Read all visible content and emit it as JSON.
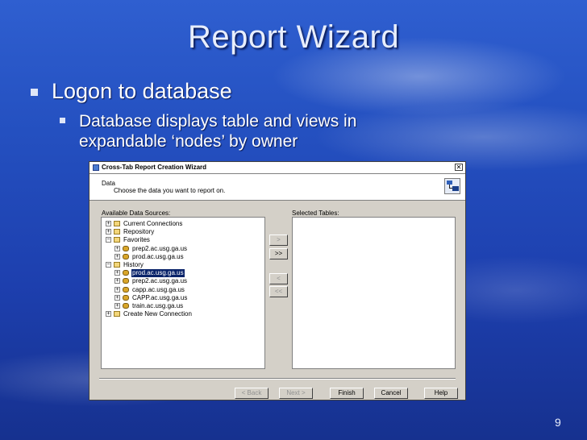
{
  "slide": {
    "title": "Report Wizard",
    "bullets": [
      {
        "text": "Logon to database",
        "level": 1
      },
      {
        "text": "Database displays table and views in expandable ‘nodes’ by owner",
        "level": 2
      }
    ],
    "page_number": "9"
  },
  "dialog": {
    "title": "Cross-Tab Report Creation Wizard",
    "close_glyph": "✕",
    "header_title": "Data",
    "header_subtitle": "Choose the data you want to report on.",
    "available_label": "Available Data Sources:",
    "selected_label": "Selected Tables:",
    "tree": [
      {
        "label": "Current Connections",
        "icon": "folder-icon",
        "expander": "+",
        "depth": 0
      },
      {
        "label": "Repository",
        "icon": "folder-icon",
        "expander": "+",
        "depth": 0
      },
      {
        "label": "Favorites",
        "icon": "folder-icon",
        "expander": "−",
        "depth": 0
      },
      {
        "label": "prep2.ac.usg.ga.us",
        "icon": "database-icon",
        "expander": "+",
        "depth": 1
      },
      {
        "label": "prod.ac.usg.ga.us",
        "icon": "database-icon",
        "expander": "+",
        "depth": 1
      },
      {
        "label": "History",
        "icon": "folder-icon",
        "expander": "−",
        "depth": 0
      },
      {
        "label": "prod.ac.usg.ga.us",
        "icon": "database-icon",
        "expander": "+",
        "depth": 1,
        "selected": true
      },
      {
        "label": "prep2.ac.usg.ga.us",
        "icon": "database-icon",
        "expander": "+",
        "depth": 1
      },
      {
        "label": "capp.ac.usg.ga.us",
        "icon": "database-icon",
        "expander": "+",
        "depth": 1
      },
      {
        "label": "CAPP.ac.usg.ga.us",
        "icon": "database-icon",
        "expander": "+",
        "depth": 1
      },
      {
        "label": "train.ac.usg.ga.us",
        "icon": "database-icon",
        "expander": "+",
        "depth": 1
      },
      {
        "label": "Create New Connection",
        "icon": "folder-icon",
        "expander": "+",
        "depth": 0
      }
    ],
    "move_buttons": [
      {
        "label": ">",
        "name": "add-button",
        "enabled": false
      },
      {
        "label": ">>",
        "name": "add-all-button",
        "enabled": true
      },
      {
        "label": "<",
        "name": "remove-button",
        "enabled": false
      },
      {
        "label": "<<",
        "name": "remove-all-button",
        "enabled": false
      }
    ],
    "footer_buttons": [
      {
        "label": "< Back",
        "name": "back-button",
        "enabled": false
      },
      {
        "label": "Next >",
        "name": "next-button",
        "enabled": false
      },
      {
        "label": "Finish",
        "name": "finish-button",
        "enabled": true
      },
      {
        "label": "Cancel",
        "name": "cancel-button",
        "enabled": true
      },
      {
        "label": "Help",
        "name": "help-button",
        "enabled": true
      }
    ]
  }
}
